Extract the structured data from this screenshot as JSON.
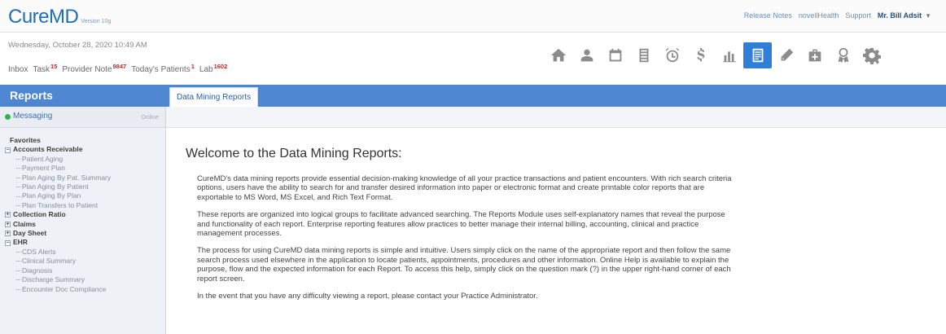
{
  "app": {
    "logo_text": "CureMD",
    "version": "Version 10g"
  },
  "toplinks": {
    "release_notes": "Release Notes",
    "novell": "novellHealth",
    "support": "Support",
    "user": "Mr. Bill Adsit"
  },
  "header": {
    "datetime": "Wednesday, October 28, 2020  10:49 AM",
    "inbox": "Inbox",
    "task": "Task",
    "task_count": "15",
    "provider_note": "Provider Note",
    "provider_note_count": "9847",
    "todays_patients": "Today's Patients",
    "todays_patients_count": "1",
    "lab": "Lab",
    "lab_count": "1602"
  },
  "toolbar_icons": [
    "home-icon",
    "person-icon",
    "calendar-icon",
    "building-icon",
    "alarm-icon",
    "dollar-icon",
    "chart-icon",
    "reports-icon",
    "pen-icon",
    "medkit-icon",
    "badge-icon",
    "gear-icon"
  ],
  "colors": {
    "accent_blue": "#4f86d1",
    "active_icon": "#2f7fd9",
    "online_green": "#2fb54a",
    "counter_red": "#d42020"
  },
  "section_title": "Reports",
  "active_tab": "Data Mining Reports",
  "messaging": {
    "label": "Messaging",
    "status": "Online"
  },
  "tree": {
    "favorites": "Favorites",
    "accounts_receivable": "Accounts Receivable",
    "ar_items": [
      "Patient Aging",
      "Payment Plan",
      "Plan Aging By Pat. Summary",
      "Plan Aging By Patient",
      "Plan Aging By Plan",
      "Plan Transfers to Patient"
    ],
    "collection_ratio": "Collection Ratio",
    "claims": "Claims",
    "day_sheet": "Day Sheet",
    "ehr": "EHR",
    "ehr_items": [
      "CDS Alerts",
      "Clinical Summary",
      "Diagnosis",
      "Discharge Summary",
      "Encounter Doc Compliance"
    ]
  },
  "content": {
    "title": "Welcome to the Data Mining Reports:",
    "p1": "CureMD's data mining reports provide essential decision-making knowledge of all your practice transactions and patient encounters. With rich search criteria options, users have the ability to search for and transfer desired information into paper or electronic format and create printable color reports that are exportable to MS Word, MS Excel, and Rich Text Format.",
    "p2": "These reports are organized into logical groups to facilitate advanced searching. The Reports Module uses self-explanatory names that reveal the purpose and functionality of each report. Enterprise reporting features allow practices to better manage their internal billing, accounting, clinical and practice management processes.",
    "p3": "The process for using CureMD data mining reports is simple and intuitive. Users simply click on the name of the appropriate report and then follow the same search process used elsewhere in the application to locate patients, appointments, procedures and other information. Online Help is available to explain the purpose, flow and the expected information for each Report. To access this help, simply click on the question mark (?) in the upper right-hand corner of each report screen.",
    "p4": "In the event that you have any difficulty viewing a report, please contact your Practice Administrator."
  }
}
